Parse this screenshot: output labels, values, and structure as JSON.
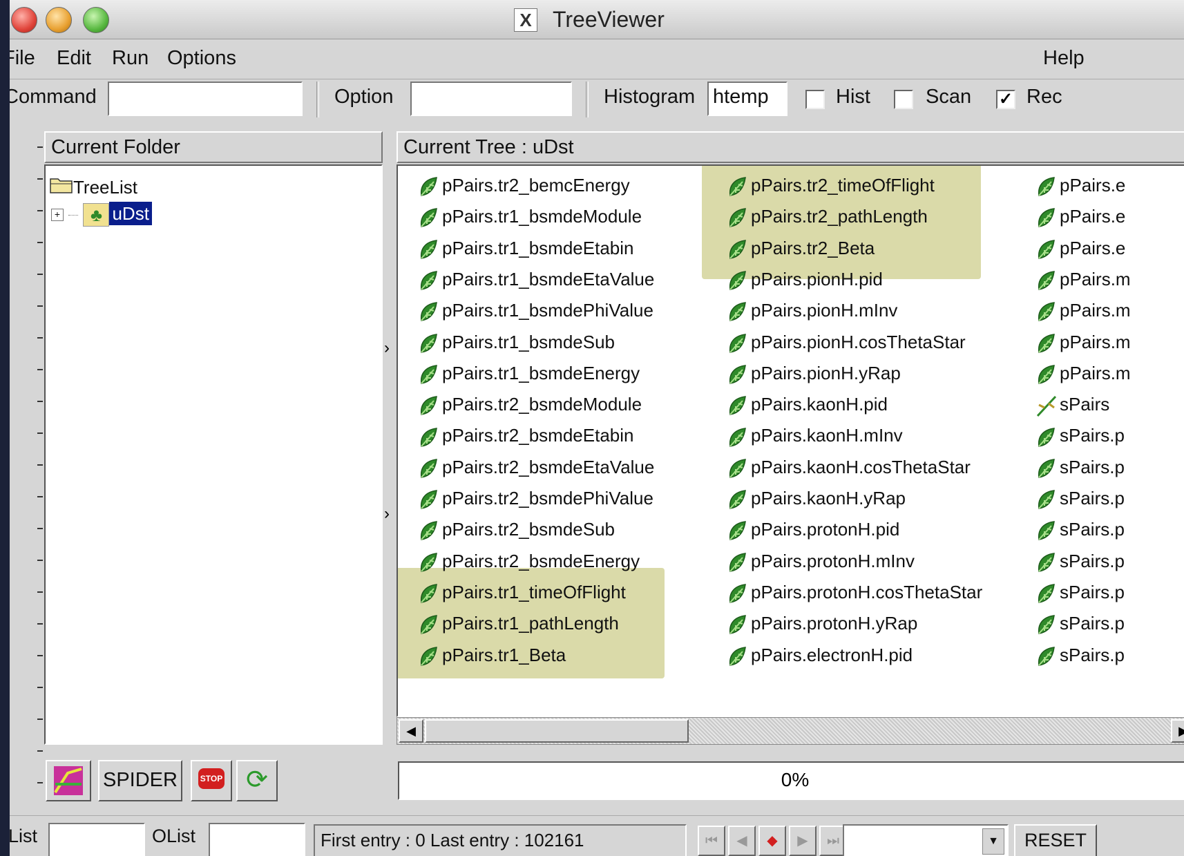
{
  "window": {
    "title": "TreeViewer",
    "x_glyph": "X"
  },
  "menu": {
    "file": "File",
    "edit": "Edit",
    "run": "Run",
    "options": "Options",
    "help": "Help"
  },
  "toolbar": {
    "command_label": "Command",
    "command_value": "",
    "option_label": "Option",
    "option_value": "",
    "histogram_label": "Histogram",
    "histogram_value": "htemp",
    "hist_label": "Hist",
    "hist_checked": false,
    "scan_label": "Scan",
    "scan_checked": false,
    "rec_label": "Rec",
    "rec_checked": true
  },
  "folder": {
    "header": "Current Folder",
    "items": [
      {
        "label": "TreeList",
        "icon": "folder-icon"
      },
      {
        "label": "uDst",
        "icon": "tree-icon",
        "selected": true
      }
    ]
  },
  "tree": {
    "header": "Current Tree : uDst",
    "columns": [
      [
        "pPairs.tr2_bemcEnergy",
        "pPairs.tr1_bsmdeModule",
        "pPairs.tr1_bsmdeEtabin",
        "pPairs.tr1_bsmdeEtaValue",
        "pPairs.tr1_bsmdePhiValue",
        "pPairs.tr1_bsmdeSub",
        "pPairs.tr1_bsmdeEnergy",
        "pPairs.tr2_bsmdeModule",
        "pPairs.tr2_bsmdeEtabin",
        "pPairs.tr2_bsmdeEtaValue",
        "pPairs.tr2_bsmdePhiValue",
        "pPairs.tr2_bsmdeSub",
        "pPairs.tr2_bsmdeEnergy",
        "pPairs.tr1_timeOfFlight",
        "pPairs.tr1_pathLength",
        "pPairs.tr1_Beta"
      ],
      [
        "pPairs.tr2_timeOfFlight",
        "pPairs.tr2_pathLength",
        "pPairs.tr2_Beta",
        "pPairs.pionH.pid",
        "pPairs.pionH.mInv",
        "pPairs.pionH.cosThetaStar",
        "pPairs.pionH.yRap",
        "pPairs.kaonH.pid",
        "pPairs.kaonH.mInv",
        "pPairs.kaonH.cosThetaStar",
        "pPairs.kaonH.yRap",
        "pPairs.protonH.pid",
        "pPairs.protonH.mInv",
        "pPairs.protonH.cosThetaStar",
        "pPairs.protonH.yRap",
        "pPairs.electronH.pid"
      ],
      [
        "pPairs.e",
        "pPairs.e",
        "pPairs.e",
        "pPairs.m",
        "pPairs.m",
        "pPairs.m",
        "pPairs.m",
        "sPairs",
        "sPairs.p",
        "sPairs.p",
        "sPairs.p",
        "sPairs.p",
        "sPairs.p",
        "sPairs.p",
        "sPairs.p",
        "sPairs.p"
      ]
    ],
    "branch_item": "sPairs"
  },
  "buttons": {
    "spider": "SPIDER",
    "stop": "STOP"
  },
  "progress": {
    "label": "0%"
  },
  "status": {
    "list_label": "List",
    "list_value": "",
    "olist_label": "OList",
    "olist_value": "",
    "entries": "First entry : 0 Last entry : 102161",
    "reset": "RESET"
  },
  "colors": {
    "leaf_green": "#2f8a2a",
    "highlight": "#cdcd8c",
    "selection": "#0a1e8c"
  }
}
